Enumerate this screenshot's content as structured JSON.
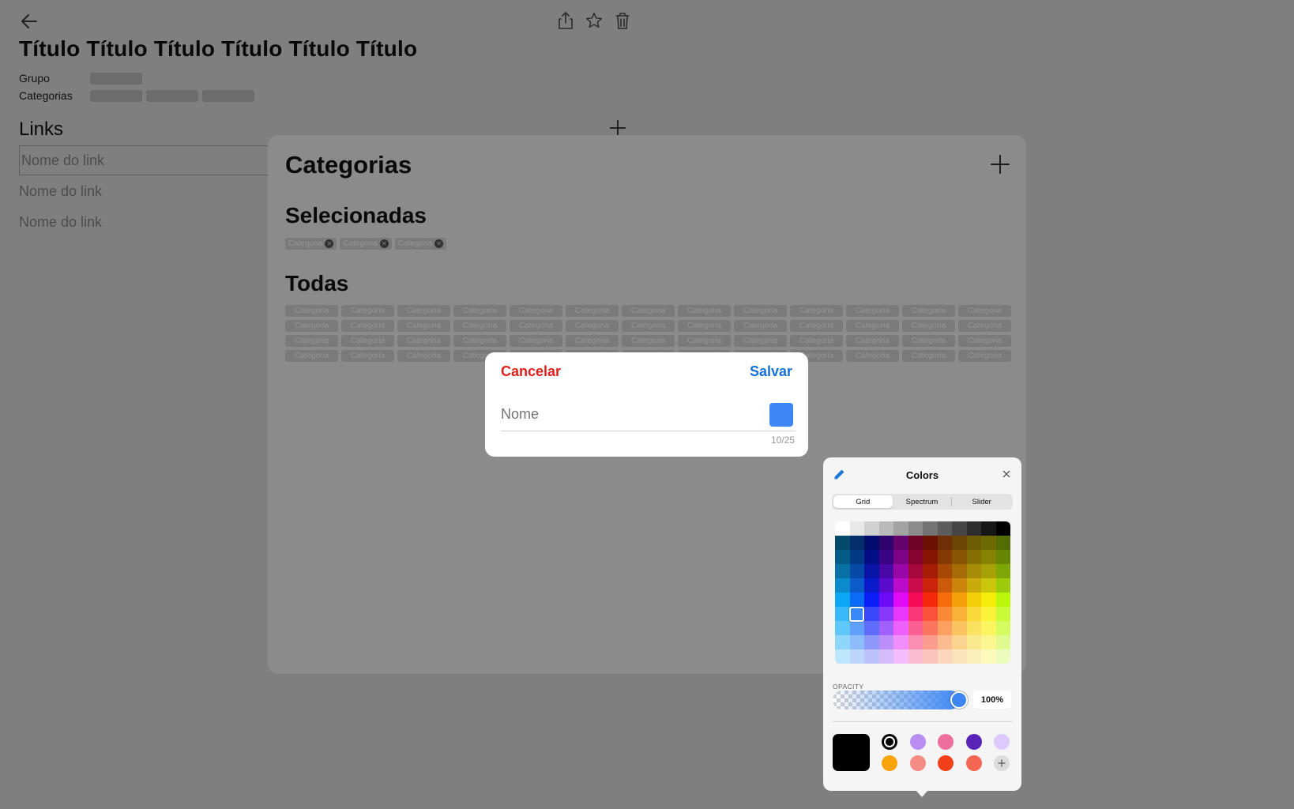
{
  "page": {
    "title": "Título Título Título Título Título Título",
    "group_label": "Grupo",
    "categories_label": "Categorias",
    "links_title": "Links",
    "link_input_placeholder": "Nome do link",
    "link_rows": [
      "Nome do link",
      "Nome do link"
    ]
  },
  "sheet": {
    "title": "Categorias",
    "selected_title": "Selecionadas",
    "all_title": "Todas",
    "selected_chips": [
      "Categoria",
      "Categoria",
      "Categoria"
    ],
    "all_chips": [
      "Categoria",
      "Categoria",
      "Categoria",
      "Categoria",
      "Categoria",
      "Categoria",
      "Categoria",
      "Categoria",
      "Categoria",
      "Categoria",
      "Categoria",
      "Categoria",
      "Categoria",
      "Categoria",
      "Categoria",
      "Categoria",
      "Categoria",
      "Categoria",
      "Categoria",
      "Categoria",
      "Categoria",
      "Categoria",
      "Categoria",
      "Categoria",
      "Categoria",
      "Categoria",
      "Categoria",
      "Categoria",
      "Categoria",
      "Categoria",
      "Categoria",
      "Categoria",
      "Categoria",
      "Categoria",
      "Categoria",
      "Categoria",
      "Categoria",
      "Categoria",
      "Categoria",
      "Categoria",
      "Categoria",
      "Categoria",
      "Categoria",
      "Categoria",
      "Categoria",
      "Categoria",
      "Categoria",
      "Categoria",
      "Categoria",
      "Categoria",
      "Categoria",
      "Categoria"
    ]
  },
  "dialog": {
    "cancel_label": "Cancelar",
    "save_label": "Salvar",
    "name_placeholder": "Nome",
    "name_value": "",
    "counter": "10/25",
    "selected_color": "#3d86f4"
  },
  "colors": {
    "title": "Colors",
    "tabs": [
      "Grid",
      "Spectrum",
      "Slider"
    ],
    "active_tab": "Grid",
    "opacity_label": "OPACITY",
    "opacity_value": "100%",
    "opacity_fraction": 1.0,
    "current_color": "#000000",
    "saved_swatches": [
      "#000000",
      "#b98ef2",
      "#ee6f9c",
      "#5a23b8",
      "#dccaff",
      "#f9a40a",
      "#f48c84",
      "#f2401b",
      "#f46651"
    ],
    "selected_swatch": 0
  }
}
